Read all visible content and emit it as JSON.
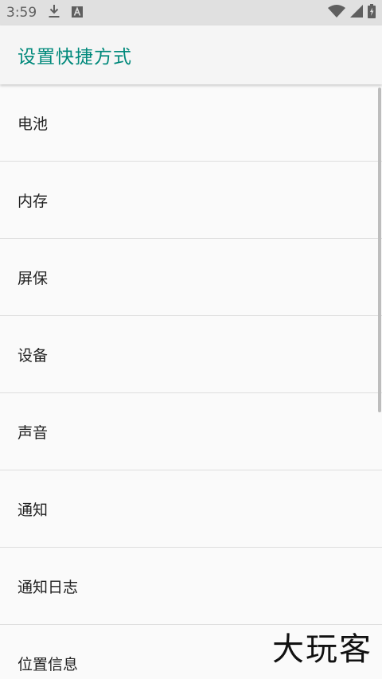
{
  "status_bar": {
    "time": "3:59",
    "icons": [
      "download-icon",
      "a-notification-icon",
      "wifi-icon",
      "signal-icon",
      "battery-icon"
    ]
  },
  "app_bar": {
    "title": "设置快捷方式"
  },
  "list": {
    "items": [
      {
        "label": "电池"
      },
      {
        "label": "内存"
      },
      {
        "label": "屏保"
      },
      {
        "label": "设备"
      },
      {
        "label": "声音"
      },
      {
        "label": "通知"
      },
      {
        "label": "通知日志"
      },
      {
        "label": "位置信息"
      }
    ]
  },
  "watermark": {
    "text": "大玩客"
  },
  "colors": {
    "accent": "#00897b",
    "status_bar_bg": "#e0e0e0",
    "app_bar_bg": "#f5f5f5",
    "background": "#fafafa",
    "divider": "#dedede",
    "text_primary": "#212121"
  }
}
